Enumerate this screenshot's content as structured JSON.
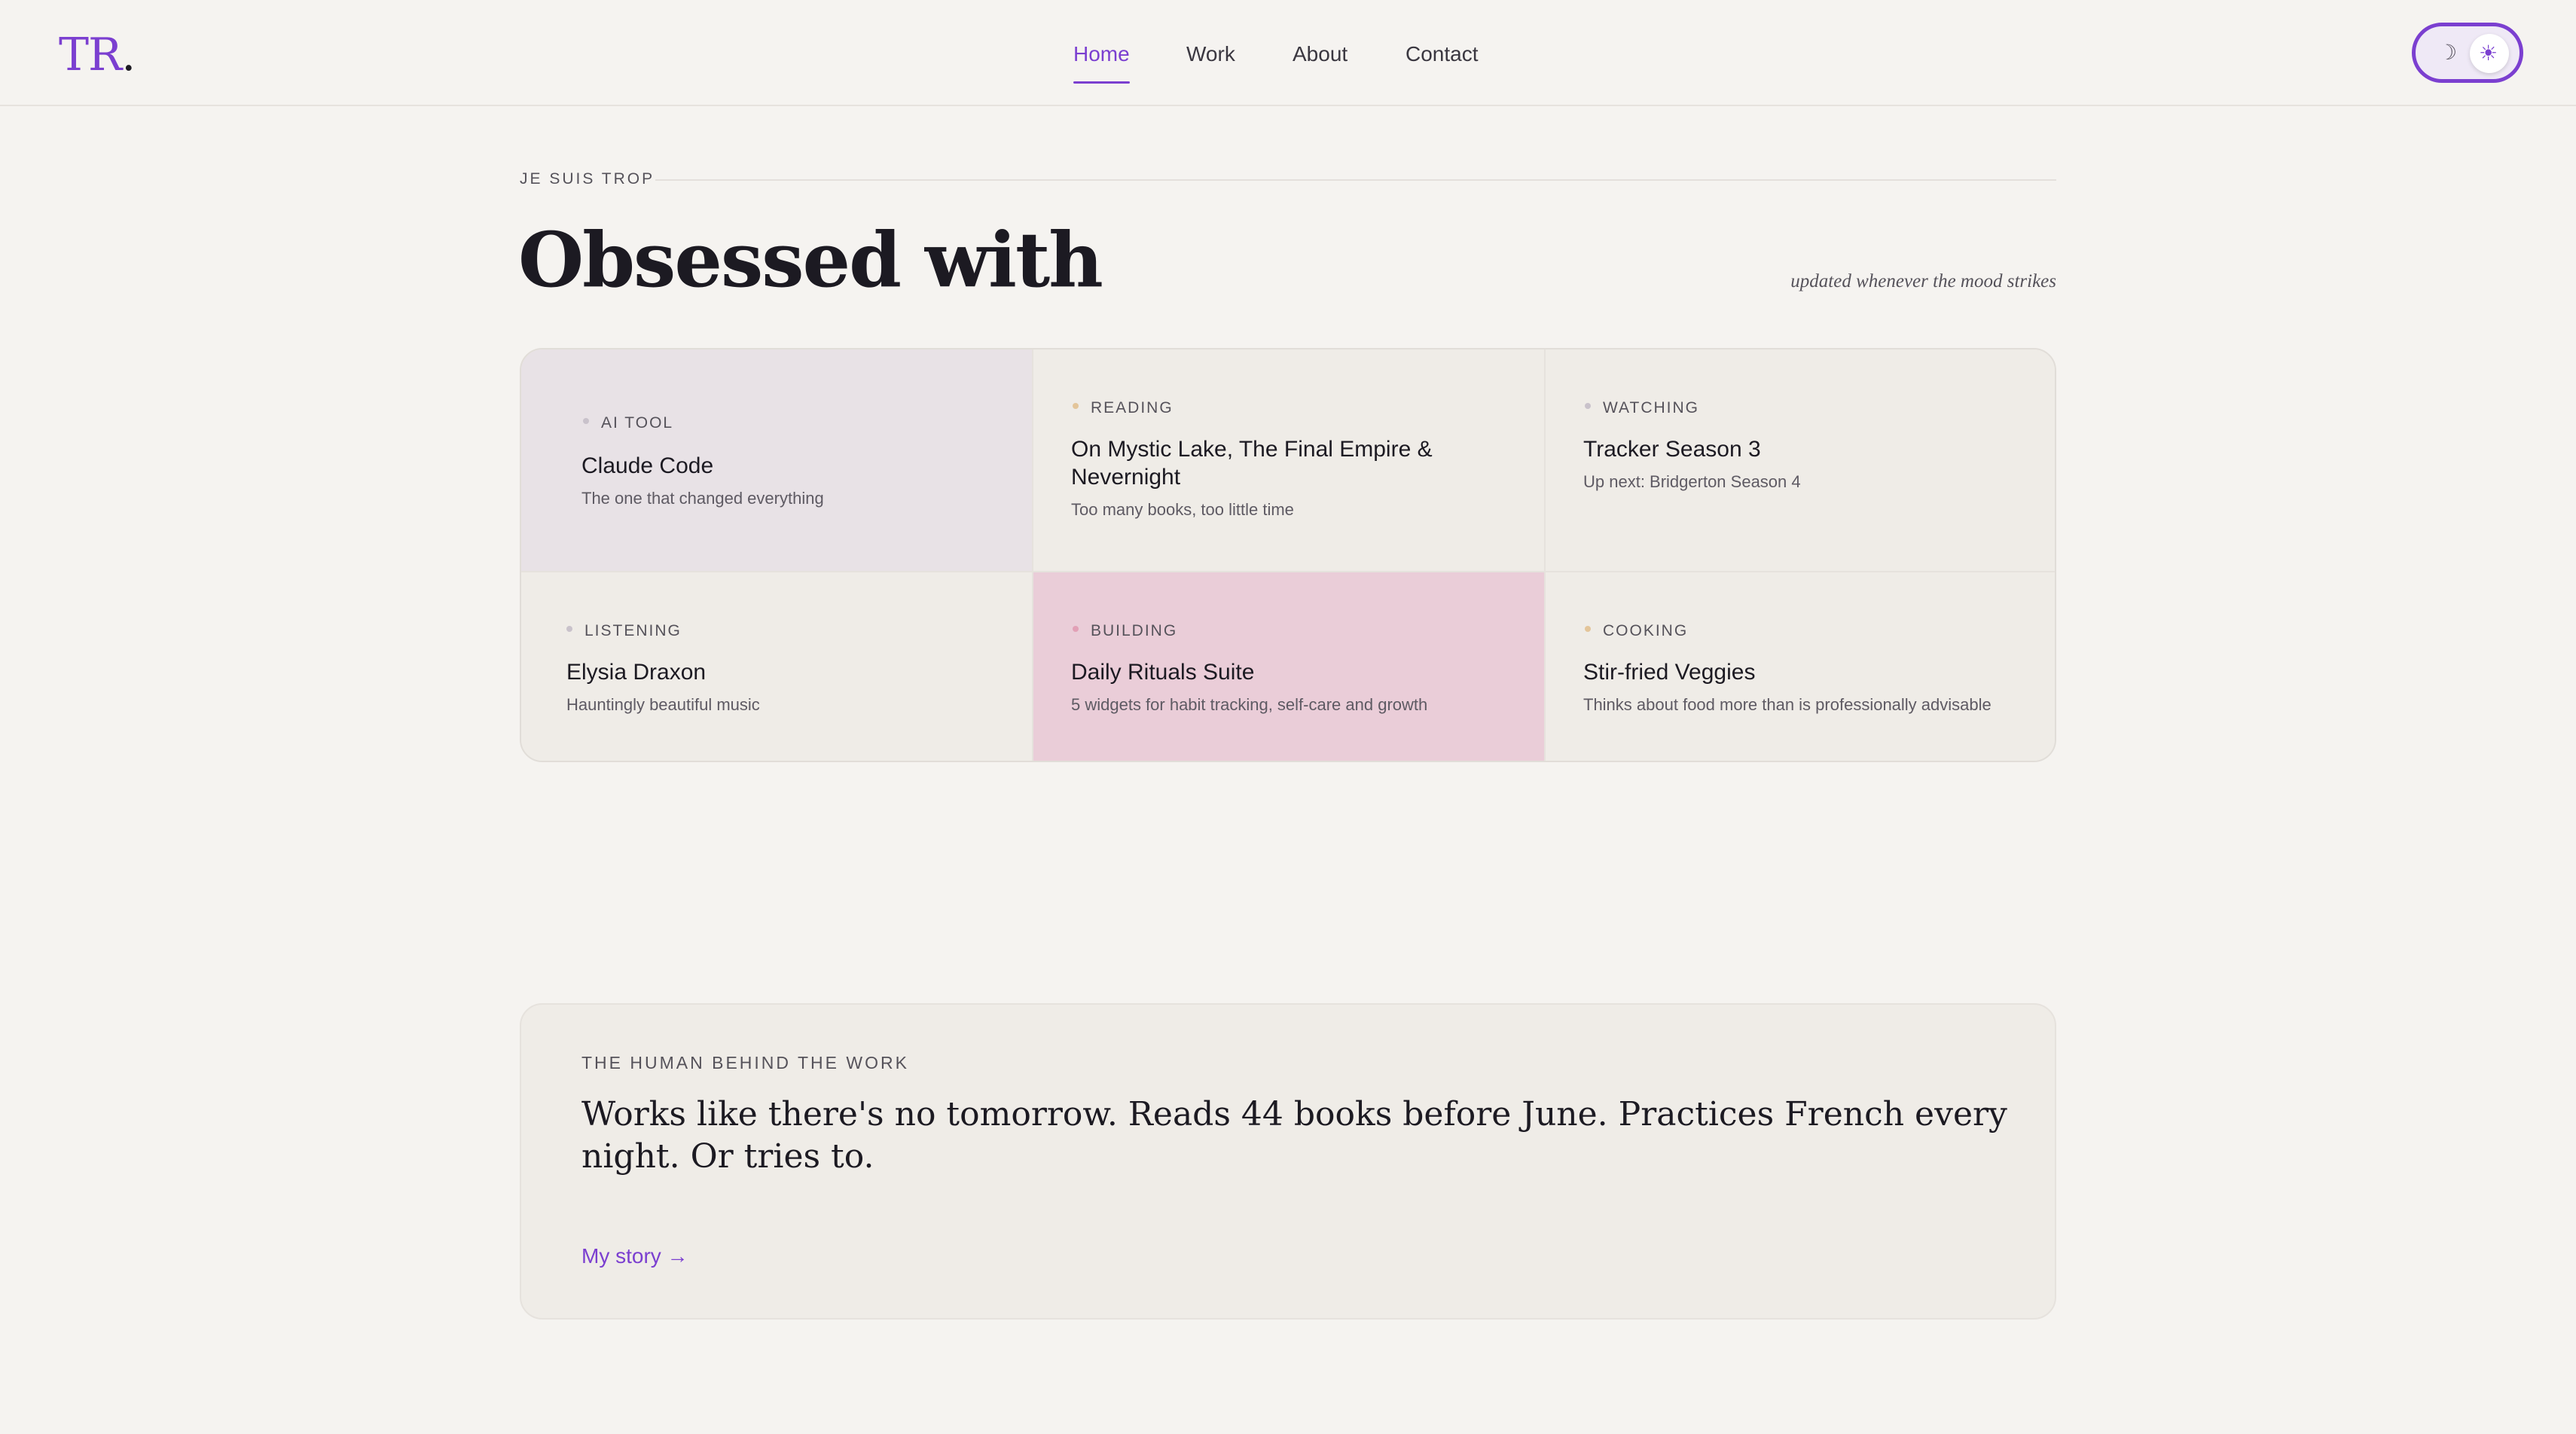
{
  "header": {
    "logo_text": "TR",
    "logo_dot": ".",
    "nav": [
      {
        "label": "Home",
        "active": true
      },
      {
        "label": "Work",
        "active": false
      },
      {
        "label": "About",
        "active": false
      },
      {
        "label": "Contact",
        "active": false
      }
    ],
    "theme_toggle": {
      "moon_icon": "☽",
      "sun_icon": "☀",
      "mode": "light"
    }
  },
  "intro": {
    "eyebrow": "JE SUIS TROP",
    "title": "Obsessed with",
    "note": "updated whenever the mood strikes"
  },
  "obsessions": [
    {
      "category": "AI TOOL",
      "title": "Claude Code",
      "subtitle": "The one that changed everything",
      "bg": "#e8e2e6",
      "dot": "#c9c2cb"
    },
    {
      "category": "READING",
      "title": "On Mystic Lake, The Final Empire & Nevernight",
      "subtitle": "Too many books, too little time",
      "bg": "#efece7",
      "dot": "#e3c59a"
    },
    {
      "category": "WATCHING",
      "title": "Tracker Season 3",
      "subtitle": "Up next: Bridgerton Season 4",
      "bg": "#efece7",
      "dot": "#c9c2cb"
    },
    {
      "category": "LISTENING",
      "title": "Elysia Draxon",
      "subtitle": "Hauntingly beautiful music",
      "bg": "#efece7",
      "dot": "#c9c2cb"
    },
    {
      "category": "BUILDING",
      "title": "Daily Rituals Suite",
      "subtitle": "5 widgets for habit tracking, self-care and growth",
      "bg": "#eacdd8",
      "dot": "#e2a0b6"
    },
    {
      "category": "COOKING",
      "title": "Stir-fried Veggies",
      "subtitle": "Thinks about food more than is professionally advisable",
      "bg": "#efece7",
      "dot": "#e3c59a"
    }
  ],
  "human": {
    "eyebrow": "THE HUMAN BEHIND THE WORK",
    "quote": "Works like there's no tomorrow. Reads 44 books before June. Practices French every night. Or tries to.",
    "link": "My story →"
  },
  "colors": {
    "accent": "#7b3fd0",
    "background": "#f5f3f0"
  }
}
